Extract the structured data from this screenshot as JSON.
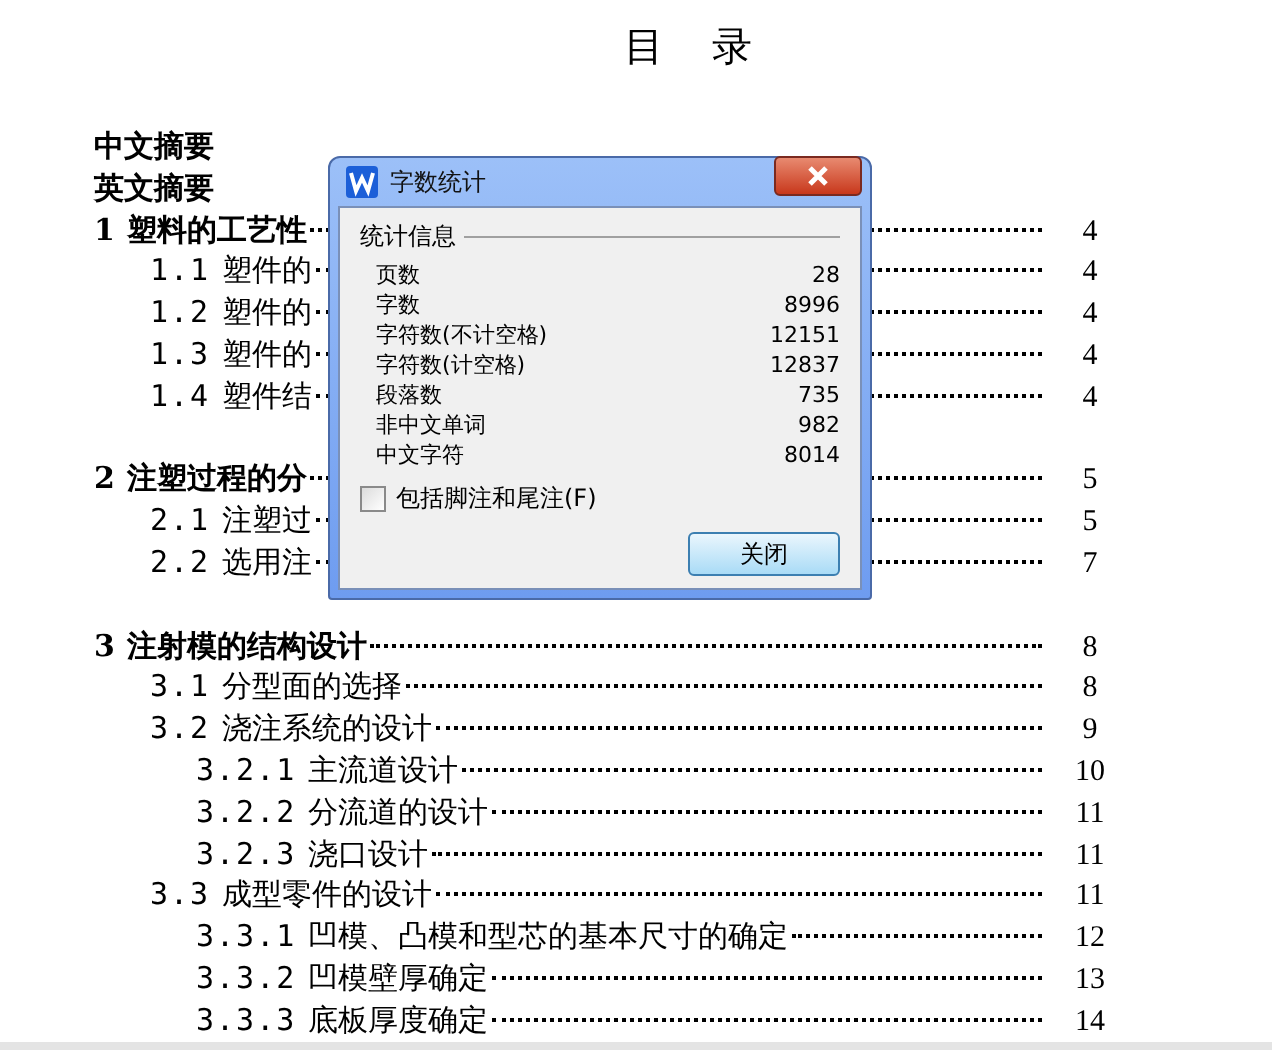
{
  "document": {
    "title": "目　录",
    "toc": [
      {
        "kind": "abstract",
        "title": "中文摘要"
      },
      {
        "kind": "abstract",
        "title": "英文摘要"
      },
      {
        "kind": "chapter",
        "number": "1",
        "title": "塑料的工艺性",
        "page": "4",
        "children": [
          {
            "kind": "section",
            "number": "1.1",
            "title": "塑件的",
            "page": "4"
          },
          {
            "kind": "section",
            "number": "1.2",
            "title": "塑件的",
            "page": "4"
          },
          {
            "kind": "section",
            "number": "1.3",
            "title": "塑件的",
            "page": "4"
          },
          {
            "kind": "section",
            "number": "1.4",
            "title": "塑件结",
            "page": "4"
          }
        ]
      },
      {
        "kind": "chapter",
        "number": "2",
        "title": "注塑过程的分",
        "page": "5",
        "children": [
          {
            "kind": "section",
            "number": "2.1",
            "title": "注塑过",
            "page": "5"
          },
          {
            "kind": "section",
            "number": "2.2",
            "title": "选用注",
            "page": "7"
          }
        ]
      },
      {
        "kind": "chapter",
        "number": "3",
        "title": "注射模的结构设计",
        "page": "8",
        "children": [
          {
            "kind": "section",
            "number": "3.1",
            "title": "分型面的选择",
            "page": "8"
          },
          {
            "kind": "section",
            "number": "3.2",
            "title": "浇注系统的设计",
            "page": "9",
            "children": [
              {
                "kind": "section",
                "number": "3.2.1",
                "title": "主流道设计",
                "page": "10"
              },
              {
                "kind": "section",
                "number": "3.2.2",
                "title": "分流道的设计",
                "page": "11"
              },
              {
                "kind": "section",
                "number": "3.2.3",
                "title": "浇口设计",
                "page": "11"
              }
            ]
          },
          {
            "kind": "section",
            "number": "3.3",
            "title": "成型零件的设计",
            "page": "11",
            "children": [
              {
                "kind": "section",
                "number": "3.3.1",
                "title": "凹模、凸模和型芯的基本尺寸的确定",
                "page": "12"
              },
              {
                "kind": "section",
                "number": "3.3.2",
                "title": "凹模壁厚确定",
                "page": "13"
              },
              {
                "kind": "section",
                "number": "3.3.3",
                "title": "底板厚度确定",
                "page": "14"
              }
            ]
          }
        ]
      }
    ]
  },
  "dialog": {
    "title": "字数统计",
    "group": "统计信息",
    "stats": [
      {
        "label": "页数",
        "value": "28"
      },
      {
        "label": "字数",
        "value": "8996"
      },
      {
        "label": "字符数(不计空格)",
        "value": "12151"
      },
      {
        "label": "字符数(计空格)",
        "value": "12837"
      },
      {
        "label": "段落数",
        "value": "735"
      },
      {
        "label": "非中文单词",
        "value": "982"
      },
      {
        "label": "中文字符",
        "value": "8014"
      }
    ],
    "checkbox": {
      "label": "包括脚注和尾注(F)",
      "checked": false
    },
    "button": "关闭"
  }
}
